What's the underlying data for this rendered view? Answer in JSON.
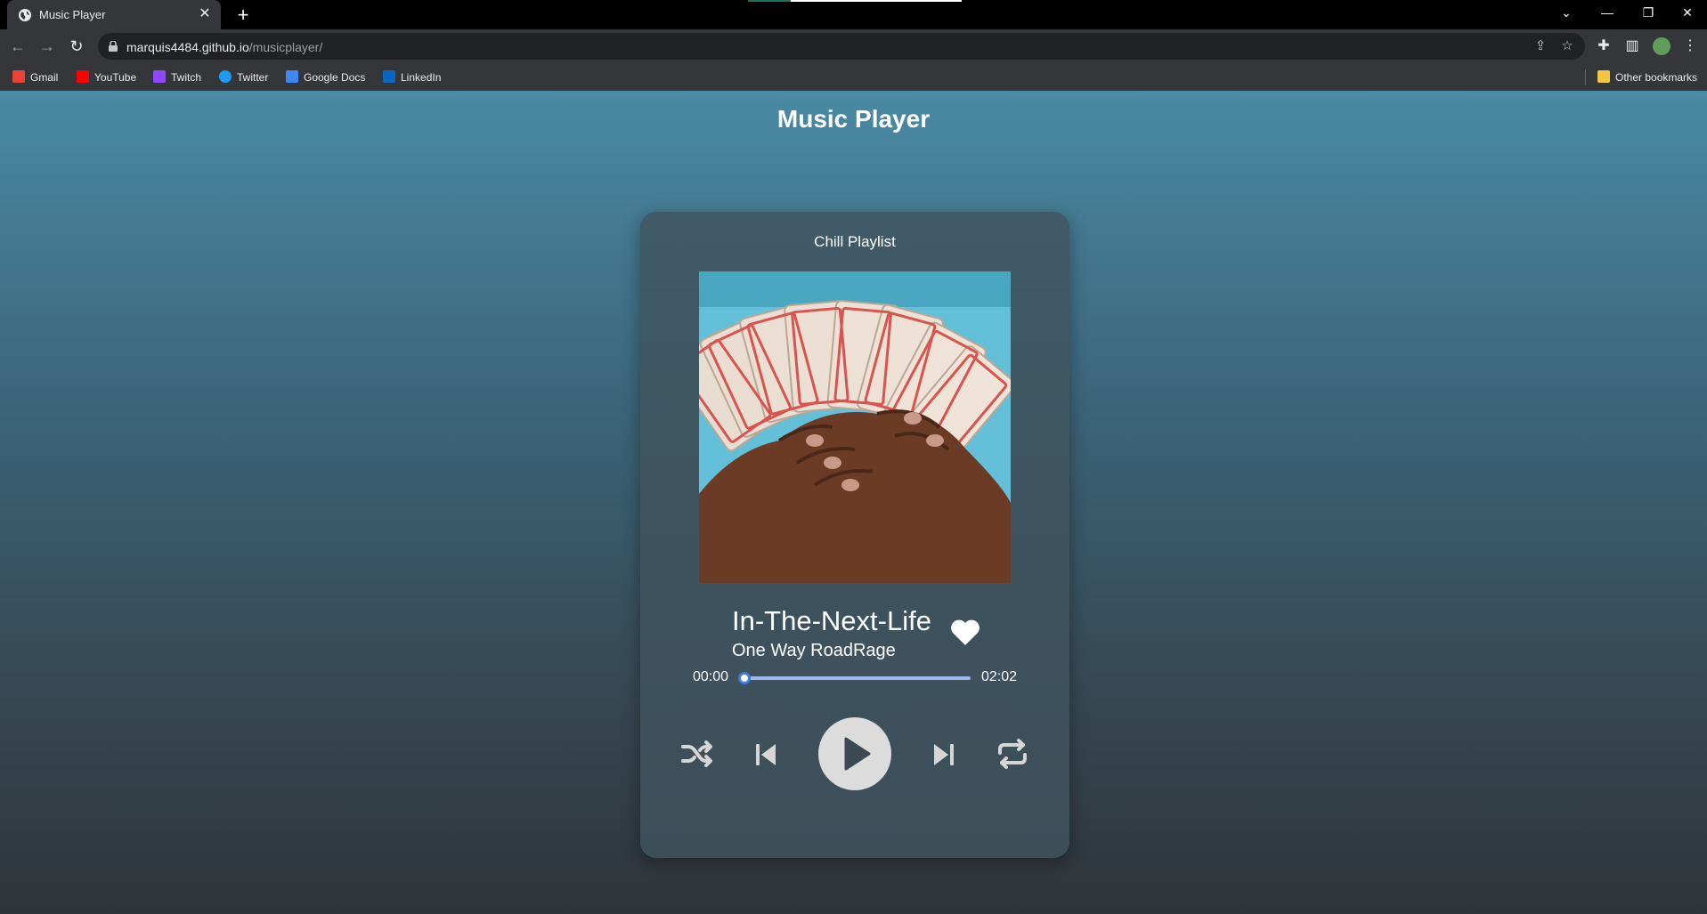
{
  "browser": {
    "tab_title": "Music Player",
    "tab_close": "✕",
    "new_tab": "+",
    "url_host": "marquis4484.github.io",
    "url_path": "/musicplayer/",
    "bookmarks": [
      "Gmail",
      "YouTube",
      "Twitch",
      "Twitter",
      "Google Docs",
      "LinkedIn"
    ],
    "other_bookmarks": "Other bookmarks"
  },
  "app": {
    "title": "Music Player",
    "playlist": "Chill Playlist",
    "song_title": "In-The-Next-Life",
    "artist": "One Way RoadRage",
    "current_time": "00:00",
    "total_time": "02:02",
    "progress": 0.0,
    "liked": true
  },
  "colors": {
    "progress_track": "#9bb8f2",
    "progress_thumb_border": "#3d7bdc",
    "play_button": "#dcdcdc",
    "control_icons": "#d6d6d6"
  },
  "icons": {
    "controls": [
      "shuffle-icon",
      "previous-icon",
      "play-icon",
      "next-icon",
      "repeat-icon"
    ]
  }
}
